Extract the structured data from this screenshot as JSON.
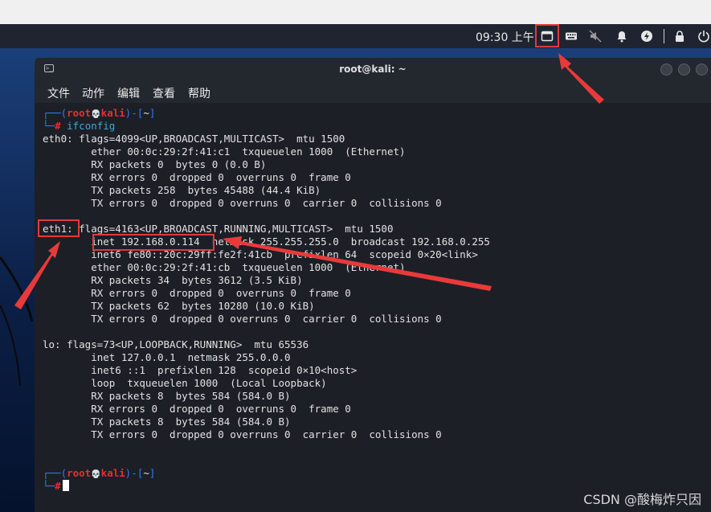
{
  "panel": {
    "clock": "09:30 上午",
    "tray_icons": [
      "terminal-icon",
      "keyboard-icon",
      "mute-icon",
      "bell-icon",
      "power-manager-icon",
      "lock-icon",
      "power-icon"
    ]
  },
  "terminal": {
    "title": "root@kali: ~",
    "menu": [
      "文件",
      "动作",
      "编辑",
      "查看",
      "帮助"
    ],
    "prompt": {
      "bracket_open": "┌──(",
      "user": "root",
      "skull": "💀",
      "host": "kali",
      "bracket_close": ")-[",
      "dir": "~",
      "bracket_end": "]",
      "hash_line": "└─",
      "hash": "#"
    },
    "command": "ifconfig",
    "output": [
      "eth0: flags=4099<UP,BROADCAST,MULTICAST>  mtu 1500",
      "        ether 00:0c:29:2f:41:c1  txqueuelen 1000  (Ethernet)",
      "        RX packets 0  bytes 0 (0.0 B)",
      "        RX errors 0  dropped 0  overruns 0  frame 0",
      "        TX packets 258  bytes 45488 (44.4 KiB)",
      "        TX errors 0  dropped 0 overruns 0  carrier 0  collisions 0",
      "",
      "eth1: flags=4163<UP,BROADCAST,RUNNING,MULTICAST>  mtu 1500",
      "        inet 192.168.0.114  netmask 255.255.255.0  broadcast 192.168.0.255",
      "        inet6 fe80::20c:29ff:fe2f:41cb  prefixlen 64  scopeid 0×20<link>",
      "        ether 00:0c:29:2f:41:cb  txqueuelen 1000  (Ethernet)",
      "        RX packets 34  bytes 3612 (3.5 KiB)",
      "        RX errors 0  dropped 0  overruns 0  frame 0",
      "        TX packets 62  bytes 10280 (10.0 KiB)",
      "        TX errors 0  dropped 0 overruns 0  carrier 0  collisions 0",
      "",
      "lo: flags=73<UP,LOOPBACK,RUNNING>  mtu 65536",
      "        inet 127.0.0.1  netmask 255.0.0.0",
      "        inet6 ::1  prefixlen 128  scopeid 0×10<host>",
      "        loop  txqueuelen 1000  (Local Loopback)",
      "        RX packets 8  bytes 584 (584.0 B)",
      "        RX errors 0  dropped 0  overruns 0  frame 0",
      "        TX packets 8  bytes 584 (584.0 B)",
      "        TX errors 0  dropped 0 overruns 0  carrier 0  collisions 0",
      "",
      ""
    ]
  },
  "watermark": "CSDN @酸梅炸只因",
  "colors": {
    "annotation": "#e03a3a",
    "prompt_blue": "#2e7cff",
    "prompt_red": "#e53030"
  }
}
